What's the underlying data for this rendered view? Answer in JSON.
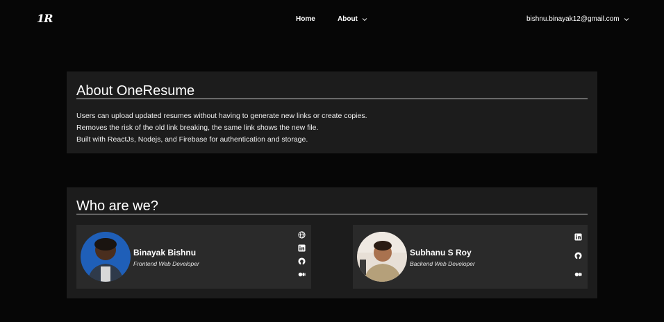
{
  "nav": {
    "logo": "1R",
    "home": "Home",
    "about": "About",
    "user_email": "bishnu.binayak12@gmail.com"
  },
  "about_card": {
    "title": "About OneResume",
    "lines": [
      "Users can upload updated resumes without having to generate new links or create copies.",
      "Removes the risk of the old link breaking, the same link shows the new file.",
      "Built with ReactJs, Nodejs, and Firebase for authentication and storage."
    ]
  },
  "team_card": {
    "title": "Who are we?",
    "members": [
      {
        "name": "Binayak Bishnu",
        "role": "Frontend Web Developer",
        "links": [
          "globe-icon",
          "linkedin-icon",
          "github-icon",
          "medium-icon"
        ]
      },
      {
        "name": "Subhanu S Roy",
        "role": "Backend Web Developer",
        "links": [
          "linkedin-icon",
          "github-icon",
          "medium-icon"
        ]
      }
    ]
  },
  "colors": {
    "page_bg": "#060606",
    "card_bg": "#1c1c1c",
    "member_bg": "#2a2a2a",
    "text": "#ffffff"
  }
}
